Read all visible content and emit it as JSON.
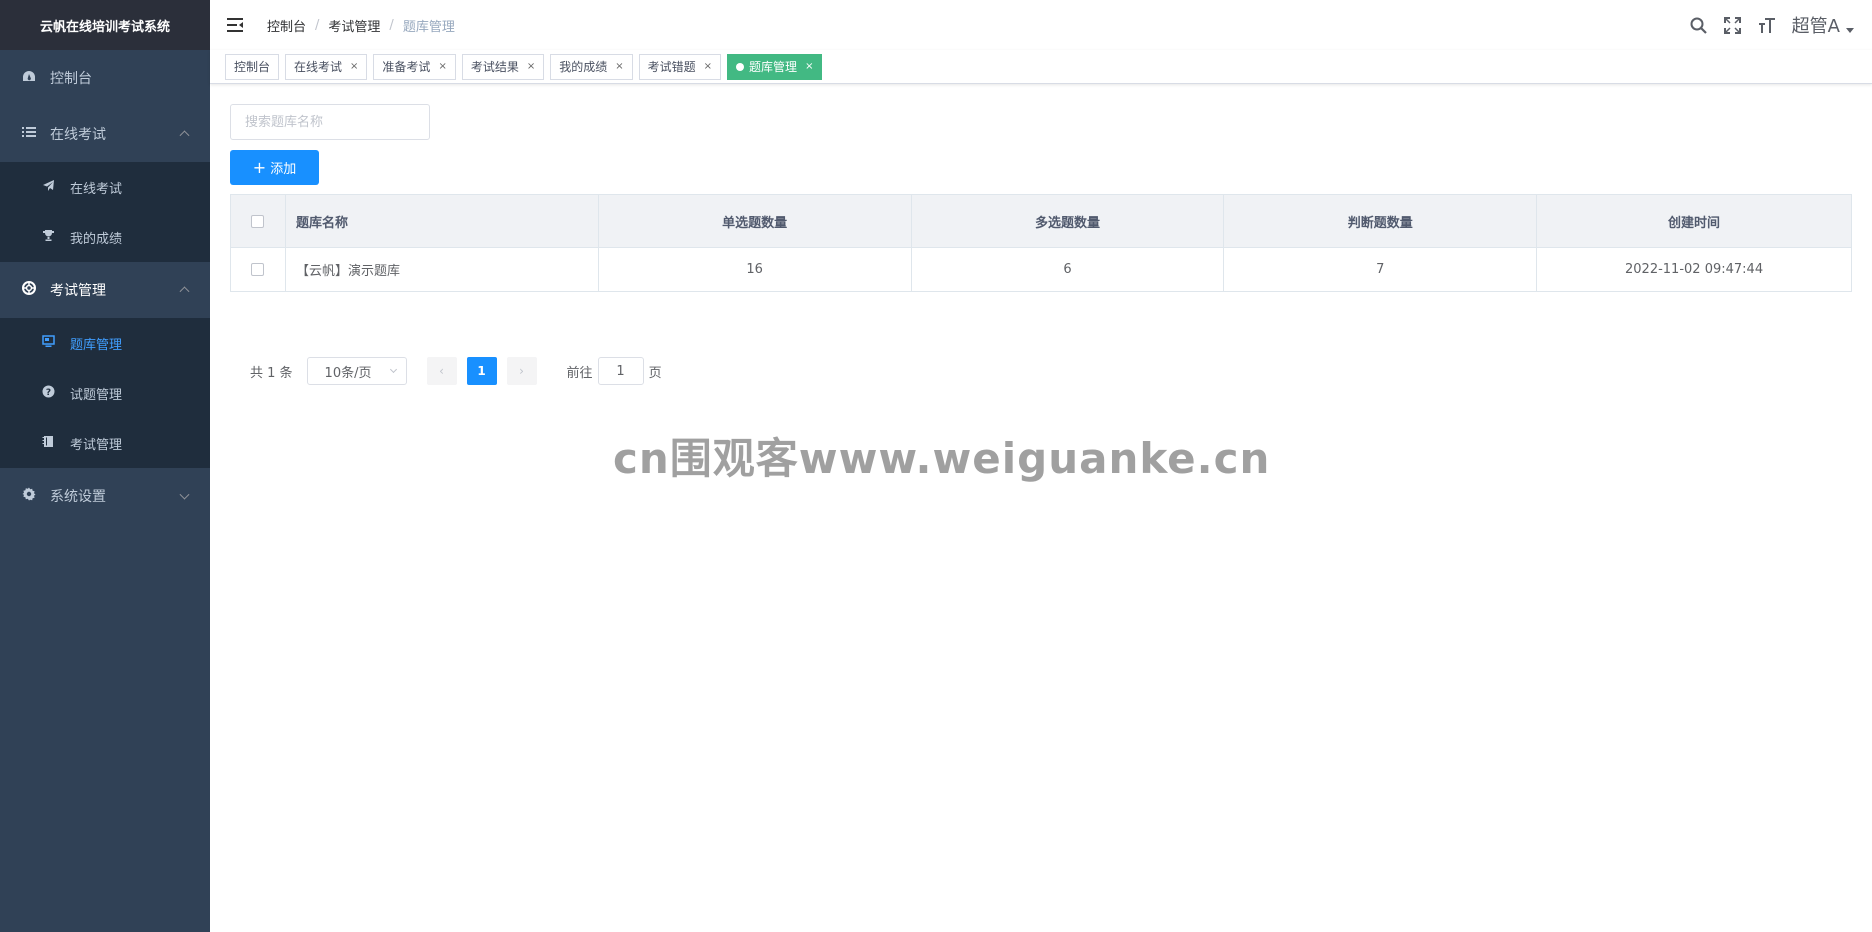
{
  "app": {
    "title": "云帆在线培训考试系统"
  },
  "sidebar": {
    "items": [
      {
        "label": "控制台",
        "icon": "dashboard-icon"
      },
      {
        "label": "在线考试",
        "icon": "list-icon",
        "expanded": true,
        "children": [
          {
            "label": "在线考试",
            "icon": "paper-plane-icon"
          },
          {
            "label": "我的成绩",
            "icon": "trophy-icon"
          }
        ]
      },
      {
        "label": "考试管理",
        "icon": "lifebuoy-icon",
        "expanded": true,
        "children": [
          {
            "label": "题库管理",
            "icon": "monitor-icon",
            "active": true
          },
          {
            "label": "试题管理",
            "icon": "question-circle-icon"
          },
          {
            "label": "考试管理",
            "icon": "book-icon"
          }
        ]
      },
      {
        "label": "系统设置",
        "icon": "gear-icon",
        "expanded": false
      }
    ]
  },
  "header": {
    "breadcrumb": [
      "控制台",
      "考试管理",
      "题库管理"
    ],
    "user": "超管A"
  },
  "tags": [
    {
      "label": "控制台",
      "closable": false
    },
    {
      "label": "在线考试",
      "closable": true
    },
    {
      "label": "准备考试",
      "closable": true
    },
    {
      "label": "考试结果",
      "closable": true
    },
    {
      "label": "我的成绩",
      "closable": true
    },
    {
      "label": "考试错题",
      "closable": true
    },
    {
      "label": "题库管理",
      "closable": true,
      "active": true
    }
  ],
  "tag_close": "×",
  "search": {
    "placeholder": "搜索题库名称",
    "value": ""
  },
  "add_button": {
    "label": "添加",
    "plus": "+"
  },
  "table": {
    "headers": [
      "题库名称",
      "单选题数量",
      "多选题数量",
      "判断题数量",
      "创建时间"
    ],
    "rows": [
      [
        "【云帆】演示题库",
        "16",
        "6",
        "7",
        "2022-11-02 09:47:44"
      ]
    ]
  },
  "pagination": {
    "total": "共 1 条",
    "page_size": "10条/页",
    "current": "1",
    "jump_prefix": "前往",
    "jump_value": "1",
    "jump_suffix": "页",
    "prev": "‹",
    "next": "›"
  },
  "watermark": "cn围观客www.weiguanke.cn",
  "colors": {
    "sidebar_bg": "#304156",
    "active_tag": "#42b983",
    "primary": "#1890ff",
    "active_menu": "#409eff"
  }
}
